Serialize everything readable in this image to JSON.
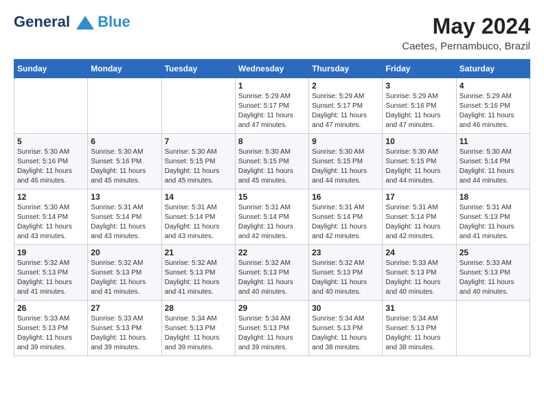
{
  "header": {
    "logo_line1": "General",
    "logo_line2": "Blue",
    "month_year": "May 2024",
    "location": "Caetes, Pernambuco, Brazil"
  },
  "weekdays": [
    "Sunday",
    "Monday",
    "Tuesday",
    "Wednesday",
    "Thursday",
    "Friday",
    "Saturday"
  ],
  "weeks": [
    [
      {
        "day": "",
        "sunrise": "",
        "sunset": "",
        "daylight": ""
      },
      {
        "day": "",
        "sunrise": "",
        "sunset": "",
        "daylight": ""
      },
      {
        "day": "",
        "sunrise": "",
        "sunset": "",
        "daylight": ""
      },
      {
        "day": "1",
        "sunrise": "Sunrise: 5:29 AM",
        "sunset": "Sunset: 5:17 PM",
        "daylight": "Daylight: 11 hours and 47 minutes."
      },
      {
        "day": "2",
        "sunrise": "Sunrise: 5:29 AM",
        "sunset": "Sunset: 5:17 PM",
        "daylight": "Daylight: 11 hours and 47 minutes."
      },
      {
        "day": "3",
        "sunrise": "Sunrise: 5:29 AM",
        "sunset": "Sunset: 5:16 PM",
        "daylight": "Daylight: 11 hours and 47 minutes."
      },
      {
        "day": "4",
        "sunrise": "Sunrise: 5:29 AM",
        "sunset": "Sunset: 5:16 PM",
        "daylight": "Daylight: 11 hours and 46 minutes."
      }
    ],
    [
      {
        "day": "5",
        "sunrise": "Sunrise: 5:30 AM",
        "sunset": "Sunset: 5:16 PM",
        "daylight": "Daylight: 11 hours and 46 minutes."
      },
      {
        "day": "6",
        "sunrise": "Sunrise: 5:30 AM",
        "sunset": "Sunset: 5:16 PM",
        "daylight": "Daylight: 11 hours and 45 minutes."
      },
      {
        "day": "7",
        "sunrise": "Sunrise: 5:30 AM",
        "sunset": "Sunset: 5:15 PM",
        "daylight": "Daylight: 11 hours and 45 minutes."
      },
      {
        "day": "8",
        "sunrise": "Sunrise: 5:30 AM",
        "sunset": "Sunset: 5:15 PM",
        "daylight": "Daylight: 11 hours and 45 minutes."
      },
      {
        "day": "9",
        "sunrise": "Sunrise: 5:30 AM",
        "sunset": "Sunset: 5:15 PM",
        "daylight": "Daylight: 11 hours and 44 minutes."
      },
      {
        "day": "10",
        "sunrise": "Sunrise: 5:30 AM",
        "sunset": "Sunset: 5:15 PM",
        "daylight": "Daylight: 11 hours and 44 minutes."
      },
      {
        "day": "11",
        "sunrise": "Sunrise: 5:30 AM",
        "sunset": "Sunset: 5:14 PM",
        "daylight": "Daylight: 11 hours and 44 minutes."
      }
    ],
    [
      {
        "day": "12",
        "sunrise": "Sunrise: 5:30 AM",
        "sunset": "Sunset: 5:14 PM",
        "daylight": "Daylight: 11 hours and 43 minutes."
      },
      {
        "day": "13",
        "sunrise": "Sunrise: 5:31 AM",
        "sunset": "Sunset: 5:14 PM",
        "daylight": "Daylight: 11 hours and 43 minutes."
      },
      {
        "day": "14",
        "sunrise": "Sunrise: 5:31 AM",
        "sunset": "Sunset: 5:14 PM",
        "daylight": "Daylight: 11 hours and 43 minutes."
      },
      {
        "day": "15",
        "sunrise": "Sunrise: 5:31 AM",
        "sunset": "Sunset: 5:14 PM",
        "daylight": "Daylight: 11 hours and 42 minutes."
      },
      {
        "day": "16",
        "sunrise": "Sunrise: 5:31 AM",
        "sunset": "Sunset: 5:14 PM",
        "daylight": "Daylight: 11 hours and 42 minutes."
      },
      {
        "day": "17",
        "sunrise": "Sunrise: 5:31 AM",
        "sunset": "Sunset: 5:14 PM",
        "daylight": "Daylight: 11 hours and 42 minutes."
      },
      {
        "day": "18",
        "sunrise": "Sunrise: 5:31 AM",
        "sunset": "Sunset: 5:13 PM",
        "daylight": "Daylight: 11 hours and 41 minutes."
      }
    ],
    [
      {
        "day": "19",
        "sunrise": "Sunrise: 5:32 AM",
        "sunset": "Sunset: 5:13 PM",
        "daylight": "Daylight: 11 hours and 41 minutes."
      },
      {
        "day": "20",
        "sunrise": "Sunrise: 5:32 AM",
        "sunset": "Sunset: 5:13 PM",
        "daylight": "Daylight: 11 hours and 41 minutes."
      },
      {
        "day": "21",
        "sunrise": "Sunrise: 5:32 AM",
        "sunset": "Sunset: 5:13 PM",
        "daylight": "Daylight: 11 hours and 41 minutes."
      },
      {
        "day": "22",
        "sunrise": "Sunrise: 5:32 AM",
        "sunset": "Sunset: 5:13 PM",
        "daylight": "Daylight: 11 hours and 40 minutes."
      },
      {
        "day": "23",
        "sunrise": "Sunrise: 5:32 AM",
        "sunset": "Sunset: 5:13 PM",
        "daylight": "Daylight: 11 hours and 40 minutes."
      },
      {
        "day": "24",
        "sunrise": "Sunrise: 5:33 AM",
        "sunset": "Sunset: 5:13 PM",
        "daylight": "Daylight: 11 hours and 40 minutes."
      },
      {
        "day": "25",
        "sunrise": "Sunrise: 5:33 AM",
        "sunset": "Sunset: 5:13 PM",
        "daylight": "Daylight: 11 hours and 40 minutes."
      }
    ],
    [
      {
        "day": "26",
        "sunrise": "Sunrise: 5:33 AM",
        "sunset": "Sunset: 5:13 PM",
        "daylight": "Daylight: 11 hours and 39 minutes."
      },
      {
        "day": "27",
        "sunrise": "Sunrise: 5:33 AM",
        "sunset": "Sunset: 5:13 PM",
        "daylight": "Daylight: 11 hours and 39 minutes."
      },
      {
        "day": "28",
        "sunrise": "Sunrise: 5:34 AM",
        "sunset": "Sunset: 5:13 PM",
        "daylight": "Daylight: 11 hours and 39 minutes."
      },
      {
        "day": "29",
        "sunrise": "Sunrise: 5:34 AM",
        "sunset": "Sunset: 5:13 PM",
        "daylight": "Daylight: 11 hours and 39 minutes."
      },
      {
        "day": "30",
        "sunrise": "Sunrise: 5:34 AM",
        "sunset": "Sunset: 5:13 PM",
        "daylight": "Daylight: 11 hours and 38 minutes."
      },
      {
        "day": "31",
        "sunrise": "Sunrise: 5:34 AM",
        "sunset": "Sunset: 5:13 PM",
        "daylight": "Daylight: 11 hours and 38 minutes."
      },
      {
        "day": "",
        "sunrise": "",
        "sunset": "",
        "daylight": ""
      }
    ]
  ]
}
